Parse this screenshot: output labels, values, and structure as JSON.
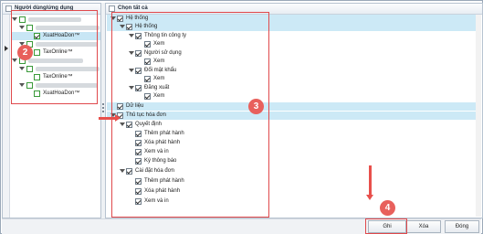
{
  "left_panel": {
    "header": "Người dùng/ứng dụng",
    "items": [
      {
        "label": "XuatHoaDon™",
        "level": "app",
        "selected": true
      },
      {
        "label": "TaxOnline™",
        "level": "app"
      },
      {
        "label": "TaxOnline™",
        "level": "app"
      },
      {
        "label": "XuatHoaDon™",
        "level": "app"
      }
    ]
  },
  "right_panel": {
    "select_all_label": "Chọn tất cả",
    "tree": [
      {
        "label": "Hệ thống",
        "depth": 0,
        "checked": true,
        "highlight": true
      },
      {
        "label": "Hệ thống",
        "depth": 1,
        "checked": true,
        "highlight": true
      },
      {
        "label": "Thông tin công ty",
        "depth": 2,
        "checked": true
      },
      {
        "label": "Xem",
        "depth": 3,
        "checked": true
      },
      {
        "label": "Người sử dụng",
        "depth": 2,
        "checked": true
      },
      {
        "label": "Xem",
        "depth": 3,
        "checked": true
      },
      {
        "label": "Đổi mật khẩu",
        "depth": 2,
        "checked": true
      },
      {
        "label": "Xem",
        "depth": 3,
        "checked": true
      },
      {
        "label": "Đăng xuất",
        "depth": 2,
        "checked": true
      },
      {
        "label": "Xem",
        "depth": 3,
        "checked": true
      },
      {
        "label": "Dữ liệu",
        "depth": 0,
        "checked": true,
        "highlight": true
      },
      {
        "label": "Thủ tục hóa đơn",
        "depth": 0,
        "checked": true,
        "highlight": true
      },
      {
        "label": "Quyết định",
        "depth": 1,
        "checked": true
      },
      {
        "label": "Thêm phát hành",
        "depth": 2,
        "checked": true
      },
      {
        "label": "Xóa phát hành",
        "depth": 2,
        "checked": true
      },
      {
        "label": "Xem và in",
        "depth": 2,
        "checked": true
      },
      {
        "label": "Ký thông báo",
        "depth": 2,
        "checked": true
      },
      {
        "label": "Cài đặt hóa đơn",
        "depth": 1,
        "checked": true
      },
      {
        "label": "Thêm phát hành",
        "depth": 2,
        "checked": true
      },
      {
        "label": "Xóa phát hành",
        "depth": 2,
        "checked": true
      },
      {
        "label": "Xem và in",
        "depth": 2,
        "checked": true
      }
    ]
  },
  "buttons": {
    "save": "Ghi",
    "delete": "Xóa",
    "close": "Đóng"
  },
  "annotations": {
    "badge_2": "2",
    "badge_3": "3",
    "badge_4": "4"
  },
  "colors": {
    "highlight_row": "#c8e6f5",
    "annotation_red": "#e0494c"
  }
}
